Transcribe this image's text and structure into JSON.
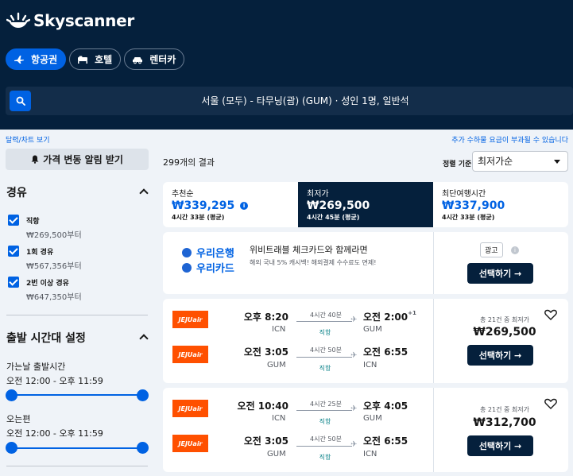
{
  "brand": {
    "name": "Skyscanner"
  },
  "nav": [
    {
      "label": "항공권",
      "icon": "plane-icon"
    },
    {
      "label": "호텔",
      "icon": "bed-icon"
    },
    {
      "label": "렌터카",
      "icon": "car-icon"
    }
  ],
  "search": {
    "summary": "서울 (모두) - 타무닝(괌) (GUM)  ·  성인 1명, 일반석"
  },
  "links": {
    "calendar": "달력/차트 보기",
    "fees_note": "추가 수하물 요금이 부과될 수 있습니다"
  },
  "alert": {
    "label": "가격 변동 알림 받기"
  },
  "results": {
    "count": "299개의 결과"
  },
  "sort": {
    "label": "정렬 기준",
    "value": "최저가순"
  },
  "filters": {
    "stops_title": "경유",
    "stops": [
      {
        "label": "직항",
        "price": "₩269,500부터"
      },
      {
        "label": "1회 경유",
        "price": "₩567,356부터"
      },
      {
        "label": "2번 이상 경유",
        "price": "₩647,350부터"
      }
    ],
    "time_title": "출발 시간대 설정",
    "outbound_label": "가는날 출발시간",
    "outbound_range": "오전 12:00 - 오후 11:59",
    "return_label": "오는편",
    "return_range": "오전 12:00 - 오후 11:59"
  },
  "tabs": [
    {
      "name": "추천순",
      "price": "₩339,295",
      "duration": "4시간 33분 (평균)"
    },
    {
      "name": "최저가",
      "price": "₩269,500",
      "duration": "4시간 45분 (평균)"
    },
    {
      "name": "최단여행시간",
      "price": "₩337,900",
      "duration": "4시간 33분 (평균)"
    }
  ],
  "ad": {
    "bank_line1": "우리은행",
    "bank_line2": "우리카드",
    "title": "위비트래블 체크카드와 함께라면",
    "subtitle": "해외 국내 5% 캐시백! 해외결제 수수료도 면제!",
    "badge": "광고",
    "cta": "선택하기 →"
  },
  "flights": [
    {
      "airline_logo_text": "JEJUair",
      "outbound": {
        "dep_time": "오후 8:20",
        "dep_code": "ICN",
        "duration": "4시간 40분",
        "stops": "직항",
        "arr_time": "오전 2:00",
        "arr_sup": "+1",
        "arr_code": "GUM"
      },
      "inbound": {
        "dep_time": "오전 3:05",
        "dep_code": "GUM",
        "duration": "4시간 50분",
        "stops": "직항",
        "arr_time": "오전 6:55",
        "arr_code": "ICN"
      },
      "deal_note": "총 21건 중 최저가",
      "price": "₩269,500",
      "cta": "선택하기 →"
    },
    {
      "airline_logo_text": "JEJUair",
      "outbound": {
        "dep_time": "오전 10:40",
        "dep_code": "ICN",
        "duration": "4시간 25분",
        "stops": "직항",
        "arr_time": "오후 4:05",
        "arr_sup": "",
        "arr_code": "GUM"
      },
      "inbound": {
        "dep_time": "오전 3:05",
        "dep_code": "GUM",
        "duration": "4시간 50분",
        "stops": "직항",
        "arr_time": "오전 6:55",
        "arr_code": "ICN"
      },
      "deal_note": "총 21건 중 최저가",
      "price": "₩312,700",
      "cta": "선택하기 →"
    }
  ]
}
